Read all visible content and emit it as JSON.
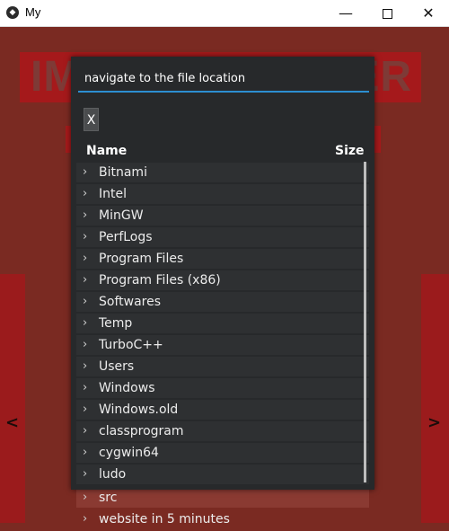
{
  "window": {
    "title": "My",
    "icon": "app-logo-icon",
    "minimize_icon": "minimize-icon",
    "maximize_icon": "maximize-icon",
    "close_icon": "close-icon",
    "close_glyph": "✕",
    "minimize_glyph": "—"
  },
  "background": {
    "banner_text_left": "IM",
    "banner_text_right": "ER",
    "prev_arrow": "<",
    "next_arrow": ">",
    "accent_color": "#a5191b",
    "bg_color": "#7a2a22"
  },
  "file_dialog": {
    "path_input_value": "navigate to the file location",
    "close_button_label": "X",
    "columns": {
      "name": "Name",
      "size": "Size"
    },
    "chevron_icon": "chevron-right-icon",
    "items": [
      {
        "name": "Bitnami"
      },
      {
        "name": "Intel"
      },
      {
        "name": "MinGW"
      },
      {
        "name": "PerfLogs"
      },
      {
        "name": "Program Files"
      },
      {
        "name": "Program Files (x86)"
      },
      {
        "name": "Softwares"
      },
      {
        "name": "Temp"
      },
      {
        "name": "TurboC++"
      },
      {
        "name": "Users"
      },
      {
        "name": "Windows"
      },
      {
        "name": "Windows.old"
      },
      {
        "name": "classprogram"
      },
      {
        "name": "cygwin64"
      },
      {
        "name": "ludo"
      }
    ],
    "overflow_items": [
      {
        "name": "src"
      },
      {
        "name": "website in 5 minutes"
      }
    ],
    "accent_color": "#2c8fd1",
    "panel_color": "#27292b"
  }
}
